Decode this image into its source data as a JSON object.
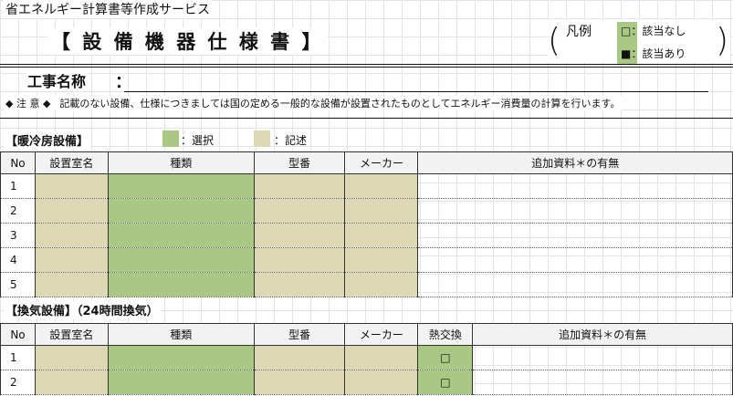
{
  "header": {
    "service_name": "省エネルギー計算書等作成サービス",
    "doc_title": "【 設 備 機 器 仕 様 書 】"
  },
  "legend": {
    "open_paren": "(",
    "close_paren": ")",
    "label": "凡例",
    "row1": "□：該当なし",
    "row2": "■：該当あり",
    "swatch_color": "#a9c883"
  },
  "project": {
    "label": "工事名称",
    "colon": "："
  },
  "note": {
    "head": "◆ 注 意 ◆",
    "text": "記載のない設備、仕様につきましては国の定める一般的な設備が設置されたものとしてエネルギー消費量の計算を行います。"
  },
  "colors": {
    "select": "#a9c883",
    "write": "#ddd8b3"
  },
  "section1": {
    "title": "【暖冷房設備】",
    "key_select": "：選択",
    "key_write": "：記述",
    "headers": [
      "No",
      "設置室名",
      "種類",
      "型番",
      "メーカー",
      "追加資料＊の有無"
    ],
    "rows": [
      "1",
      "2",
      "3",
      "4",
      "5"
    ]
  },
  "section2": {
    "title": "【換気設備】（24時間換気）",
    "headers": [
      "No",
      "設置室名",
      "種類",
      "型番",
      "メーカー",
      "熱交換",
      "追加資料＊の有無"
    ],
    "rows": [
      {
        "no": "1",
        "heat_exchange": "□"
      },
      {
        "no": "2",
        "heat_exchange": "□"
      }
    ]
  }
}
